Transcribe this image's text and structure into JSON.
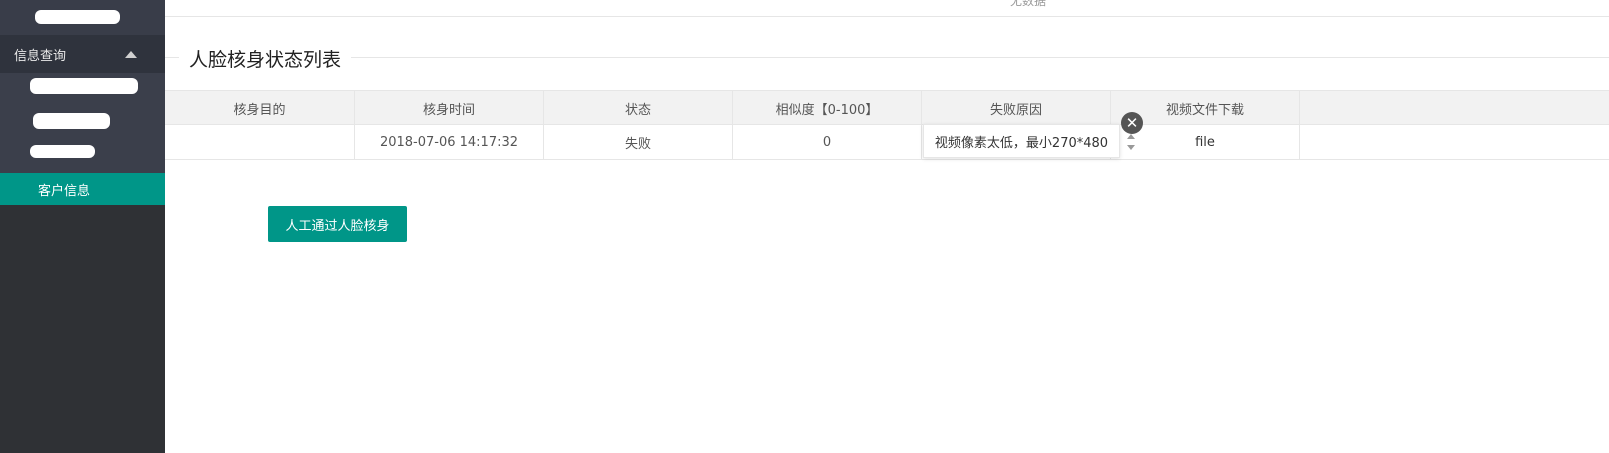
{
  "sidebar": {
    "group_label": "信息查询",
    "active_item": "客户信息"
  },
  "top": {
    "no_data": "无数据"
  },
  "section": {
    "title": "人脸核身状态列表"
  },
  "table": {
    "headers": [
      "核身目的",
      "核身时间",
      "状态",
      "相似度【0-100】",
      "失败原因",
      "视频文件下载"
    ],
    "row": {
      "purpose": "",
      "time": "2018-07-06 14:17:32",
      "status": "失败",
      "similarity": "0",
      "reason": "",
      "download": "file"
    }
  },
  "tooltip": {
    "text": "视频像素太低，最小270*480",
    "close_icon": "close-icon"
  },
  "actions": {
    "approve_label": "人工通过人脸核身"
  },
  "colors": {
    "accent": "#009688",
    "sidebar_bg": "#393d49"
  }
}
